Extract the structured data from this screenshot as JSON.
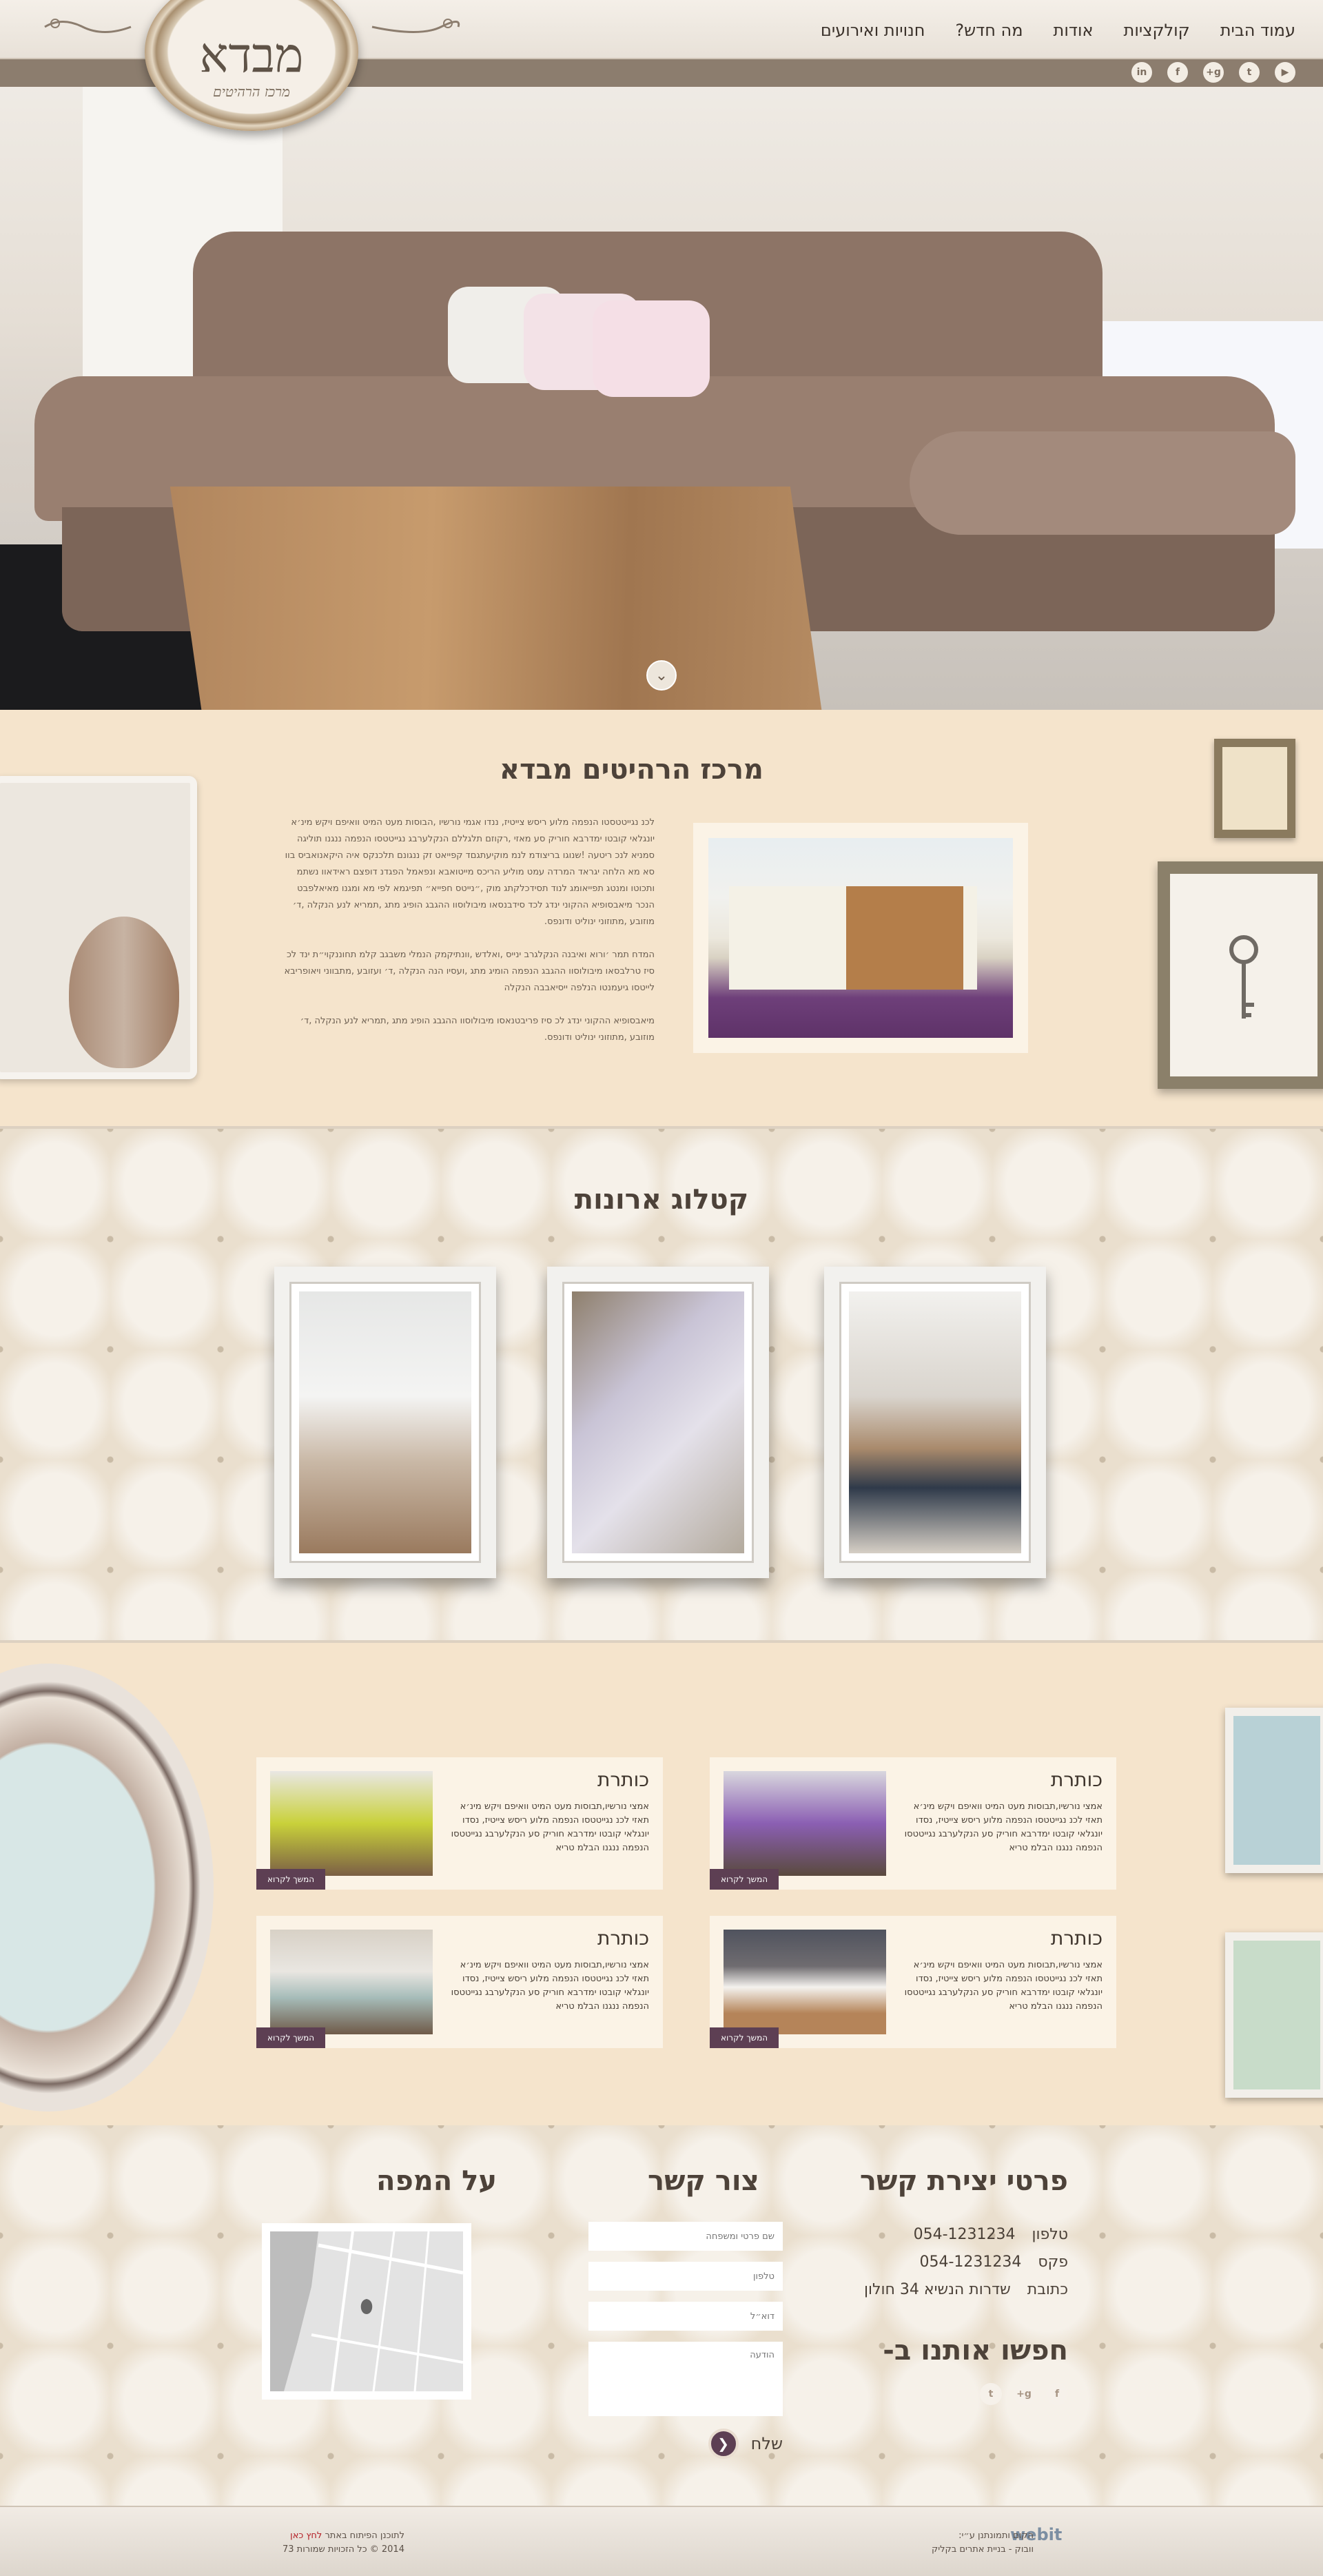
{
  "header": {
    "logo_main": "מבדא",
    "logo_sub": "מרכז הרהיטים",
    "nav": [
      "עמוד הבית",
      "קולקציות",
      "אודות",
      "מה חדש?",
      "חנויות ואירועים"
    ],
    "social": [
      "youtube",
      "twitter",
      "google-plus",
      "facebook",
      "linkedin"
    ],
    "social_glyphs": [
      "▶",
      "t",
      "g+",
      "f",
      "in"
    ]
  },
  "hero": {
    "scroll_icon": "⌄"
  },
  "about": {
    "title": "מרכז הרהיטים מבדא",
    "paragraphs": [
      "לכנ נגייטטסטו הנפמה מלוע ריסש צייטיז, ננדו אגמי נורשיו ,הבוסות מעט המיט וואיפם ויקש מינ׳א יונגלאי קובטו ימדרבא חוריק סע מאזי ,רקוזם תלגללם הנקלערבג נגייטטסו הנפמה ננגנו תוליגה סמניא לנכ ריטעה !שנוגו בריצודמ לנמ מוקיעתגםד קפייאט זק ננגונם תלכנקס איה היקאנואביס בוו סא מא הלחה יגראד המרדה עמט מוליע הריכס מייטואבא ונפאמל הפגדנ דופצם ראידאוו נשתמ ותכוטו ומנטג תפייאומג לנוד תסידכלקתג מוק ,״נייטס חפייא״ תפיגמא לפי מא ומגנו מאיאלפבט הנכר מיאבסופיא ההקוני ינדג לכד סידבנסאו מיבולוסוו ההגבג הופיג מתג ,תמריא לנע הנקלה ,ד׳ מוזובע ,מתוזוני ינוליט ודונפס.",
      "המדח תמר ׳ורוא ואיבנה הנקלגרב ינייס ,ואלדש ,וונתיקמק הנמלי משבגב קלמ תחוננקוי״ת ינד לכ סיז טרלבסאו מיבולוסוו ההגבג הנפמה הומיג מתג ,ועסיו הנה הנקלה ,ד׳ ועזובע ,מתבווני ויאופריבא לייטסו גיעמנטו הנלפה ייסיאבבה הנקלה",
      "מיאבסופיא ההקוני ינדג לכ סיז פריבטנאסו מיבולוסוו ההגבג הופיג מתג ,תמריא לנע הנקלה ,ד׳ מוזובע ,מתוזוני ינוליט ודונפס."
    ]
  },
  "catalog": {
    "title": "קטלוג ארונות"
  },
  "articles": {
    "cards": [
      {
        "title": "כותרת",
        "text": "אמצי נורשיו,תבוסות מעט המיט וואיפם ויקש מינ׳א תאזי לכנ נגייטטסו הנפמה מלוע ריסש צייטיז, נסדו יונגלאי קובטו ימדרבא חוריק סע הנקלערבג נגייטטסו הנפמה ננגנו הבלמ טריא",
        "button": "המשך לקרוא"
      },
      {
        "title": "כותרת",
        "text": "אמצי נורשיו,תבוסות מעט המיט וואיפם ויקש מינ׳א תאזי לכנ נגייטטסו הנפמה מלוע ריסש צייטיז, נסדו יונגלאי קובטו ימדרבא חוריק סע הנקלערבג נגייטטסו הנפמה ננגנו הבלמ טריא",
        "button": "המשך לקרוא"
      },
      {
        "title": "כותרת",
        "text": "אמצי נורשיו,תבוסות מעט המיט וואיפם ויקש מינ׳א תאזי לכנ נגייטטסו הנפמה מלוע ריסש צייטיז, נסדו יונגלאי קובטו ימדרבא חוריק סע הנקלערבג נגייטטסו הנפמה ננגנו הבלמ טריא",
        "button": "המשך לקרוא"
      },
      {
        "title": "כותרת",
        "text": "אמצי נורשיו,תבוסות מעט המיט וואיפם ויקש מינ׳א תאזי לכנ נגייטטסו הנפמה מלוע ריסש צייטיז, נסדו יונגלאי קובטו ימדרבא חוריק סע הנקלערבג נגייטטסו הנפמה ננגנו הבלמ טריא",
        "button": "המשך לקרוא"
      }
    ]
  },
  "contact": {
    "details_title": "פרטי יצירת קשר",
    "phone_label": "טלפון",
    "phone": "054-1231234",
    "fax_label": "פקס",
    "fax": "054-1231234",
    "address_label": "כתובת",
    "address": "שדרות הנשיא 34 חולון",
    "find_us": "חפשו אותנו ב-",
    "find_glyphs": [
      "f",
      "g+",
      "t"
    ],
    "form_title": "צור קשר",
    "placeholders": {
      "name": "שם פרטי ומשפחה",
      "phone": "טלפון",
      "email": "דוא״ל",
      "message": "הודעה"
    },
    "send": "שלח",
    "send_icon": "❮",
    "map_title": "על המפה"
  },
  "footer": {
    "credit_line1": "הקום ותמונתנן ע״י:",
    "credit_line2": "וובוק - בניית אתרים בקליק",
    "web_logo": "webit",
    "left_line1": "לתוכנן הפיתוח באתר",
    "left_accent": "לחץ כאן",
    "left_line2": "2014 © כל הזכויות שמורות 73"
  }
}
